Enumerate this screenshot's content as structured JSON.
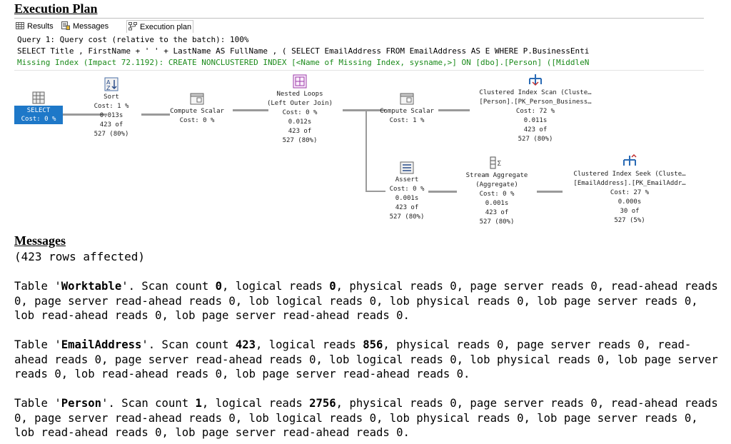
{
  "titles": {
    "execution_plan": "Execution Plan",
    "messages": "Messages"
  },
  "tabs": [
    {
      "label": "Results",
      "icon": "grid-icon"
    },
    {
      "label": "Messages",
      "icon": "messages-icon"
    },
    {
      "label": "Execution plan",
      "icon": "execution-plan-icon",
      "active": true
    }
  ],
  "sql": {
    "line1": "Query 1: Query cost (relative to the batch): 100%",
    "line2": "SELECT Title , FirstName + ' ' + LastName AS FullName , ( SELECT EmailAddress FROM EmailAddress AS E WHERE P.BusinessEnti",
    "line3": "Missing Index (Impact 72.1192): CREATE NONCLUSTERED INDEX [<Name of Missing Index, sysname,>] ON [dbo].[Person] ([MiddleN"
  },
  "plan": {
    "select": {
      "l1": "SELECT",
      "l2": "Cost: 0 %"
    },
    "sort": {
      "l1": "Sort",
      "l2": "Cost: 1 %",
      "l3": "0.013s",
      "l4": "423 of",
      "l5": "527 (80%)"
    },
    "compute1": {
      "l1": "Compute Scalar",
      "l2": "Cost: 0 %"
    },
    "nested": {
      "l1": "Nested Loops",
      "l2": "(Left Outer Join)",
      "l3": "Cost: 0 %",
      "l4": "0.012s",
      "l5": "423 of",
      "l6": "527 (80%)"
    },
    "compute2": {
      "l1": "Compute Scalar",
      "l2": "Cost: 1 %"
    },
    "clustered_scan": {
      "l1": "Clustered Index Scan (Cluste…",
      "l2": "[Person].[PK_Person_Business…",
      "l3": "Cost: 72 %",
      "l4": "0.011s",
      "l5": "423 of",
      "l6": "527 (80%)"
    },
    "assert": {
      "l1": "Assert",
      "l2": "Cost: 0 %",
      "l3": "0.001s",
      "l4": "423 of",
      "l5": "527 (80%)"
    },
    "stream": {
      "l1": "Stream Aggregate",
      "l2": "(Aggregate)",
      "l3": "Cost: 0 %",
      "l4": "0.001s",
      "l5": "423 of",
      "l6": "527 (80%)"
    },
    "seek": {
      "l1": "Clustered Index Seek (Cluste…",
      "l2": "[EmailAddress].[PK_EmailAddr…",
      "l3": "Cost: 27 %",
      "l4": "0.000s",
      "l5": "30 of",
      "l6": "527 (5%)"
    }
  },
  "messages": {
    "rows_affected": "(423 rows affected)",
    "t1": {
      "prefix": "Table '",
      "name": "Worktable",
      "mid": "'. Scan count ",
      "scan": "0",
      "mid2": ", logical reads ",
      "logical": "0",
      "rest": ", physical reads 0, page server reads 0, read-ahead reads 0, page server read-ahead reads 0, lob logical reads 0, lob physical reads 0, lob page server reads 0, lob read-ahead reads 0, lob page server read-ahead reads 0."
    },
    "t2": {
      "prefix": "Table '",
      "name": "EmailAddress",
      "mid": "'. Scan count ",
      "scan": "423",
      "mid2": ", logical reads ",
      "logical": "856",
      "rest": ", physical reads 0, page server reads 0, read-ahead reads 0, page server read-ahead reads 0, lob logical reads 0, lob physical reads 0, lob page server reads 0, lob read-ahead reads 0, lob page server read-ahead reads 0."
    },
    "t3": {
      "prefix": "Table '",
      "name": "Person",
      "mid": "'. Scan count ",
      "scan": "1",
      "mid2": ", logical reads ",
      "logical": "2756",
      "rest": ", physical reads 0, page server reads 0, read-ahead reads 0, page server read-ahead reads 0, lob logical reads 0, lob physical reads 0, lob page server reads 0, lob read-ahead reads 0, lob page server read-ahead reads 0."
    }
  },
  "colors": {
    "select_bg": "#1e78c8",
    "missing_index": "#1a8a1a",
    "connector": "#9a9a9a"
  }
}
